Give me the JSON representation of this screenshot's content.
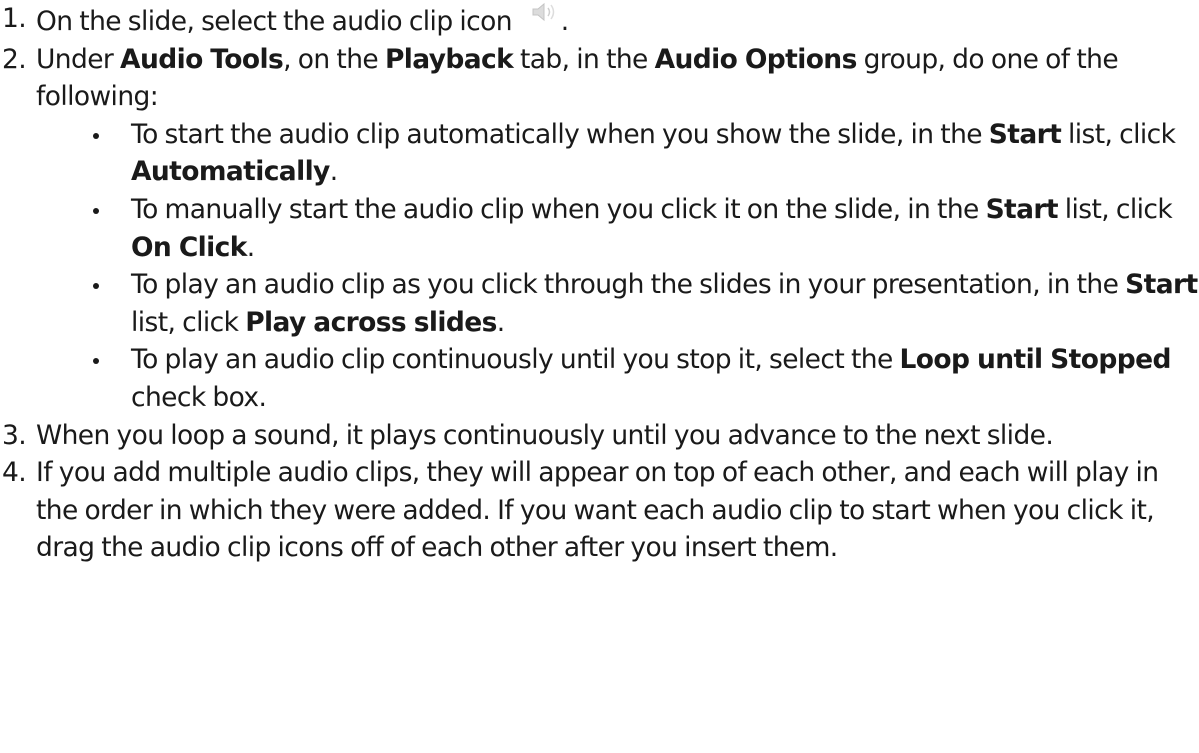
{
  "steps": [
    {
      "number": "1.",
      "parts": [
        "On the slide, select the audio clip icon ",
        "."
      ]
    },
    {
      "number": "2.",
      "parts": [
        "Under ",
        "Audio Tools",
        ", on the ",
        "Playback",
        " tab, in the ",
        "Audio Options",
        " group, do one of the following:"
      ],
      "options": [
        {
          "parts": [
            "To start the audio clip automatically when you show the slide, in the ",
            "Start",
            " list, click ",
            "Automatically",
            "."
          ]
        },
        {
          "parts": [
            "To manually start the audio clip when you click it on the slide, in the ",
            "Start",
            " list, click ",
            "On Click",
            "."
          ]
        },
        {
          "parts": [
            "To play an audio clip as you click through the slides in your presentation, in the ",
            "Start",
            " list, click ",
            "Play across slides",
            "."
          ]
        },
        {
          "parts": [
            "To play an audio clip continuously until you stop it, select the ",
            "Loop until Stopped",
            " check box."
          ]
        }
      ]
    },
    {
      "number": "3.",
      "text": "When you loop a sound, it plays continuously until you advance to the next slide."
    },
    {
      "number": "4.",
      "text": "If you add multiple audio clips, they will appear on top of each other, and each will play in the order in which they were added. If you want each audio clip to start when you click it, drag the audio clip icons off of each other after you insert them."
    }
  ],
  "icons": {
    "audio_clip": "speaker-icon"
  }
}
